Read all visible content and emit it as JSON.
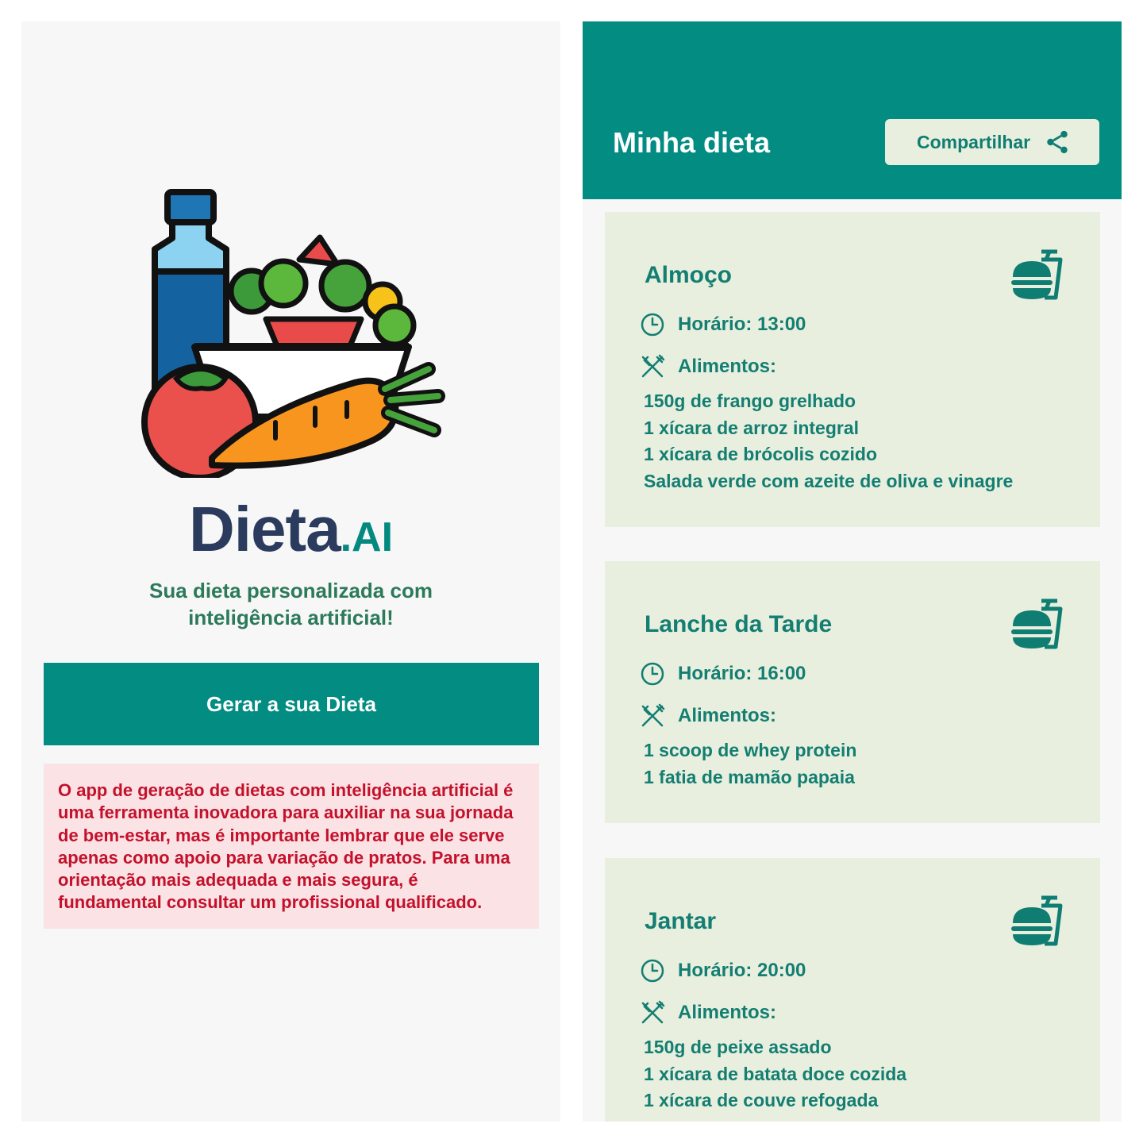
{
  "home": {
    "brand_name": "Dieta",
    "brand_suffix": ".AI",
    "tagline_line1": "Sua dieta personalizada com",
    "tagline_line2": "inteligência artificial!",
    "generate_button": "Gerar a sua Dieta",
    "disclaimer": "O app de geração de dietas com inteligência artificial é uma ferramenta inovadora para auxiliar na sua jornada de bem-estar, mas é importante lembrar que ele serve apenas como apoio para variação de pratos. Para uma orientação mais adequada e mais segura, é fundamental consultar um profissional qualificado."
  },
  "diet": {
    "title": "Minha dieta",
    "share_label": "Compartilhar",
    "meals": [
      {
        "title": "Almoço",
        "time_label": "Horário: 13:00",
        "foods_label": "Alimentos:",
        "foods": [
          "150g de frango grelhado",
          "1 xícara de arroz integral",
          "1 xícara de brócolis cozido",
          "Salada verde com azeite de oliva e vinagre"
        ]
      },
      {
        "title": "Lanche da Tarde",
        "time_label": "Horário: 16:00",
        "foods_label": "Alimentos:",
        "foods": [
          "1 scoop de whey protein",
          "1 fatia de mamão papaia"
        ]
      },
      {
        "title": "Jantar",
        "time_label": "Horário: 20:00",
        "foods_label": "Alimentos:",
        "foods": [
          "150g de peixe assado",
          "1 xícara de batata doce cozida",
          "1 xícara de couve refogada"
        ]
      }
    ]
  },
  "icons": {
    "logo": "salad-bowl-water-bottle-tomato-carrot-illustration",
    "share": "share-icon",
    "meal": "burger-and-drink-icon",
    "time": "clock-icon",
    "foods": "fork-and-knife-icon"
  },
  "colors": {
    "primary": "#028c82",
    "card_background": "#e8efdf",
    "meal_text": "#137e71",
    "brand_dark": "#2a3b5e",
    "disclaimer_background": "#fae2e5",
    "disclaimer_text": "#c4112b"
  }
}
